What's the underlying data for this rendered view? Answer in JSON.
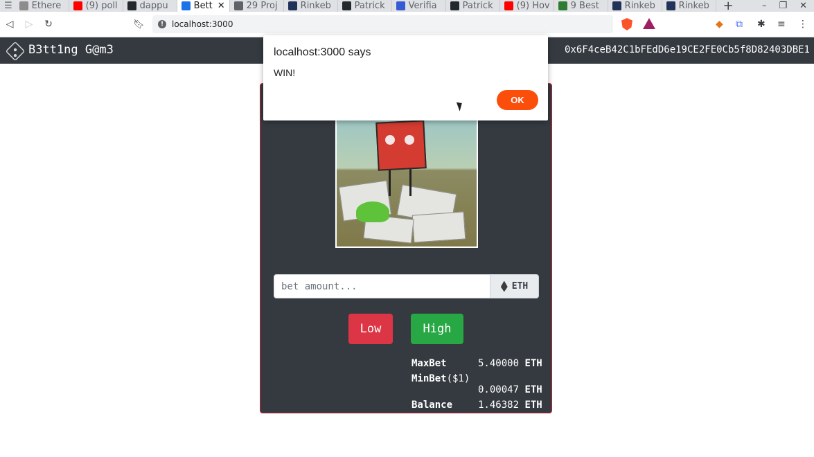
{
  "browser": {
    "tabs": [
      {
        "label": "Ethere",
        "icon": "ethereum-icon",
        "color": "#8c8c8c"
      },
      {
        "label": "(9) poll",
        "icon": "youtube-icon",
        "color": "#ff0000"
      },
      {
        "label": "dappu",
        "icon": "github-icon",
        "color": "#24292e"
      },
      {
        "label": "Bett",
        "icon": "app-icon",
        "color": "#1a73e8",
        "active": true
      },
      {
        "label": "29 Proj",
        "icon": "at-icon",
        "color": "#5f6368"
      },
      {
        "label": "Rinkeb",
        "icon": "etherscan-icon",
        "color": "#21325b"
      },
      {
        "label": "Patrick",
        "icon": "github-icon",
        "color": "#24292e"
      },
      {
        "label": "Verifia",
        "icon": "chainlink-icon",
        "color": "#375bd2"
      },
      {
        "label": "Patrick",
        "icon": "github-icon",
        "color": "#24292e"
      },
      {
        "label": "(9) Hov",
        "icon": "youtube-icon",
        "color": "#ff0000"
      },
      {
        "label": "9 Best",
        "icon": "site-icon",
        "color": "#2e7d32"
      },
      {
        "label": "Rinkeb",
        "icon": "etherscan-icon",
        "color": "#21325b"
      },
      {
        "label": "Rinkeb",
        "icon": "etherscan-icon",
        "color": "#21325b"
      }
    ],
    "new_tab": "+",
    "url": "localhost:3000",
    "window_controls": [
      "–",
      "❐",
      "✕"
    ]
  },
  "app": {
    "brand": "B3tt1ng G@m3",
    "account": "0x6F4ceB42C1bFEdD6e19CE2FE0Cb5f8D82403DBE1"
  },
  "bet": {
    "placeholder": "bet amount...",
    "unit": "ETH",
    "low_label": "Low",
    "high_label": "High"
  },
  "stats": {
    "maxbet_label": "MaxBet",
    "maxbet_value": "5.40000",
    "minbet_label": "MinBet",
    "minbet_suffix": "($1)",
    "minbet_value": "0.00047",
    "balance_label": "Balance",
    "balance_value": "1.46382",
    "unit": "ETH"
  },
  "dialog": {
    "title": "localhost:3000 says",
    "message": "WIN!",
    "ok_label": "OK"
  },
  "colors": {
    "navbar": "#343a40",
    "low": "#dc3545",
    "high": "#28a745",
    "ok": "#fb4e0a"
  }
}
